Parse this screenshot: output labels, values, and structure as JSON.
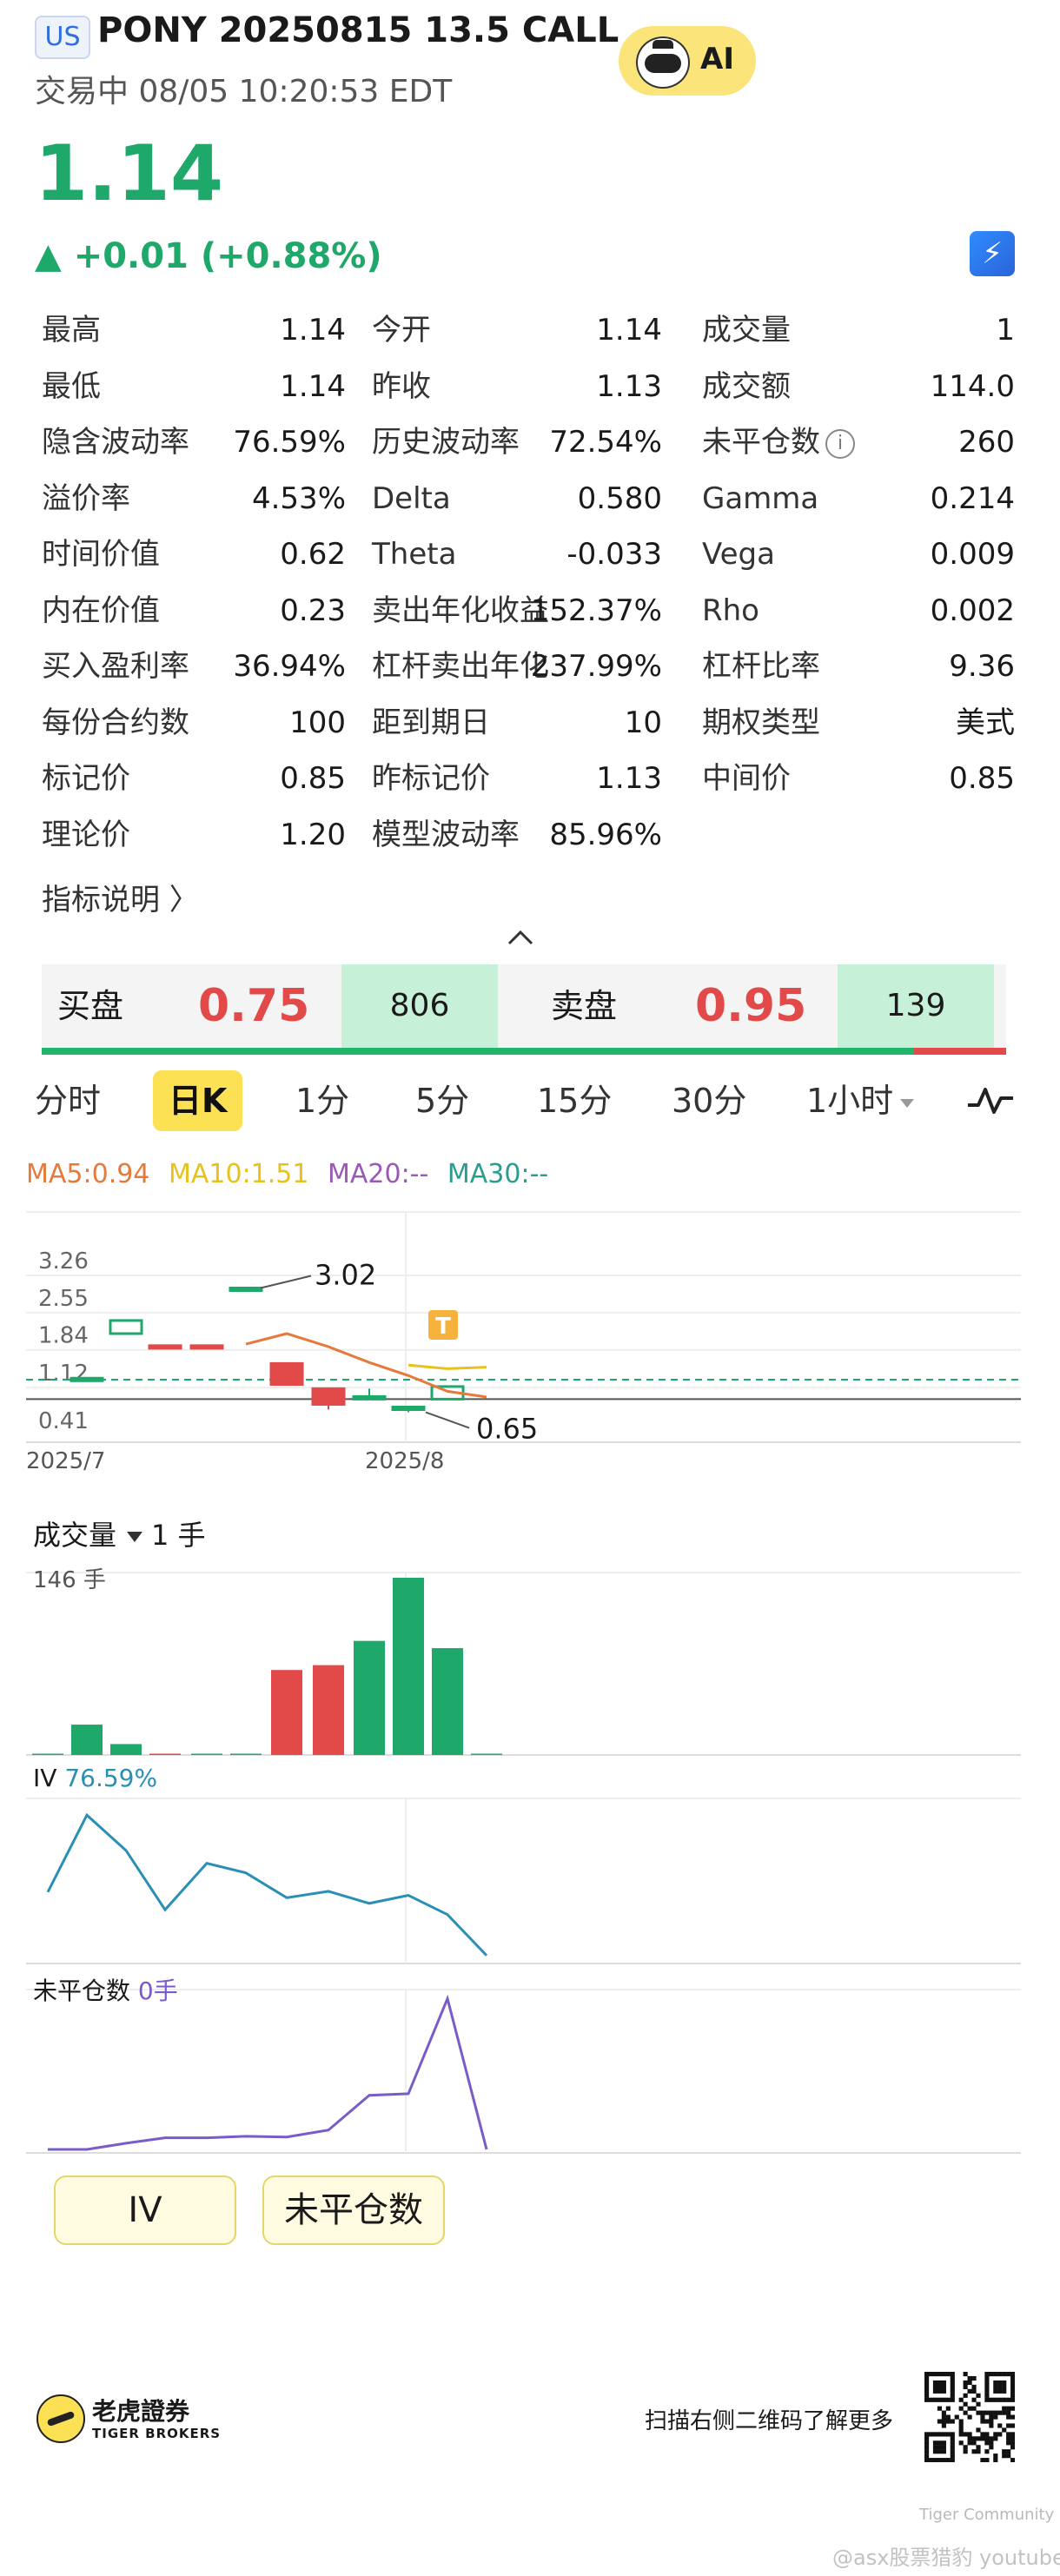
{
  "header": {
    "market": "US",
    "title": "PONY 20250815 13.5 CALL",
    "status": "交易中 08/05 10:20:53 EDT",
    "ai_label": "AI"
  },
  "quote": {
    "price": "1.14",
    "change": "▲ +0.01 (+0.88%)",
    "color_up": "#1ea86a",
    "color_down": "#e24a4a"
  },
  "stats": [
    [
      [
        "最高",
        "1.14"
      ],
      [
        "今开",
        "1.14"
      ],
      [
        "成交量",
        "1"
      ]
    ],
    [
      [
        "最低",
        "1.14"
      ],
      [
        "昨收",
        "1.13"
      ],
      [
        "成交额",
        "114.0"
      ]
    ],
    [
      [
        "隐含波动率",
        "76.59%"
      ],
      [
        "历史波动率",
        "72.54%"
      ],
      [
        "未平仓数",
        "260"
      ]
    ],
    [
      [
        "溢价率",
        "4.53%"
      ],
      [
        "Delta",
        "0.580"
      ],
      [
        "Gamma",
        "0.214"
      ]
    ],
    [
      [
        "时间价值",
        "0.62"
      ],
      [
        "Theta",
        "-0.033"
      ],
      [
        "Vega",
        "0.009"
      ]
    ],
    [
      [
        "内在价值",
        "0.23"
      ],
      [
        "卖出年化收益",
        "152.37%"
      ],
      [
        "Rho",
        "0.002"
      ]
    ],
    [
      [
        "买入盈利率",
        "36.94%"
      ],
      [
        "杠杆卖出年化",
        "237.99%"
      ],
      [
        "杠杆比率",
        "9.36"
      ]
    ],
    [
      [
        "每份合约数",
        "100"
      ],
      [
        "距到期日",
        "10"
      ],
      [
        "期权类型",
        "美式"
      ]
    ],
    [
      [
        "标记价",
        "0.85"
      ],
      [
        "昨标记价",
        "1.13"
      ],
      [
        "中间价",
        "0.85"
      ]
    ],
    [
      [
        "理论价",
        "1.20"
      ],
      [
        "模型波动率",
        "85.96%"
      ],
      [
        "",
        ""
      ]
    ]
  ],
  "indicator_link": "指标说明 〉",
  "order_book": {
    "bid_label": "买盘",
    "bid_price": "0.75",
    "bid_size": "806",
    "ask_label": "卖盘",
    "ask_price": "0.95",
    "ask_size": "139"
  },
  "tabs": [
    "分时",
    "日K",
    "1分",
    "5分",
    "15分",
    "30分",
    "1小时"
  ],
  "active_tab": "日K",
  "ma": {
    "ma5": "MA5:0.94",
    "ma10": "MA10:1.51",
    "ma20": "MA20:--",
    "ma30": "MA30:--",
    "colors": {
      "ma5": "#e57a3a",
      "ma10": "#e8c21c",
      "ma20": "#9b59b6",
      "ma30": "#2a9d8f"
    }
  },
  "chart_data": [
    {
      "type": "candlestick",
      "y_ticks": [
        "3.26",
        "2.55",
        "1.84",
        "1.12",
        "0.41"
      ],
      "x_labels": [
        "2025/7",
        "2025/8"
      ],
      "annotations": [
        "3.02",
        "0.65"
      ],
      "reference_line": 1.14,
      "candles": [
        {
          "open": 1.3,
          "close": 1.3,
          "high": 1.3,
          "low": 1.3,
          "dir": "up"
        },
        {
          "open": 2.15,
          "close": 2.4,
          "high": 2.4,
          "low": 2.15,
          "dir": "up"
        },
        {
          "open": 1.92,
          "close": 1.92,
          "high": 1.92,
          "low": 1.92,
          "dir": "down"
        },
        {
          "open": 1.92,
          "close": 1.92,
          "high": 1.92,
          "low": 1.92,
          "dir": "down"
        },
        {
          "open": 3.02,
          "close": 3.02,
          "high": 3.02,
          "low": 3.02,
          "dir": "up"
        },
        {
          "open": 1.58,
          "close": 1.18,
          "high": 1.58,
          "low": 1.18,
          "dir": "down"
        },
        {
          "open": 1.1,
          "close": 0.8,
          "high": 1.1,
          "low": 0.7,
          "dir": "down"
        },
        {
          "open": 0.95,
          "close": 0.95,
          "high": 1.1,
          "low": 0.9,
          "dir": "up"
        },
        {
          "open": 0.7,
          "close": 0.75,
          "high": 0.75,
          "low": 0.65,
          "dir": "up"
        },
        {
          "open": 0.9,
          "close": 1.14,
          "high": 1.14,
          "low": 0.9,
          "dir": "up"
        }
      ],
      "ma5": [
        null,
        null,
        null,
        null,
        1.95,
        2.15,
        1.9,
        1.6,
        1.35,
        1.05,
        0.94
      ],
      "ma10": [
        null,
        null,
        null,
        null,
        null,
        null,
        null,
        null,
        1.55,
        1.48,
        1.51
      ]
    },
    {
      "type": "bar",
      "title": "成交量",
      "unit": "1 手",
      "max_label": "146 手",
      "values": [
        0,
        25,
        9,
        1,
        0,
        0,
        70,
        74,
        94,
        146,
        88,
        0
      ],
      "colors": [
        "up",
        "up",
        "up",
        "down",
        "up",
        "up",
        "down",
        "down",
        "up",
        "up",
        "up",
        "up"
      ]
    },
    {
      "type": "line",
      "title": "IV",
      "value_label": "76.59%",
      "values": [
        1.04,
        2.0,
        1.56,
        0.82,
        1.4,
        1.28,
        0.97,
        1.05,
        0.9,
        1.0,
        0.76,
        0.25
      ]
    },
    {
      "type": "line",
      "title": "未平仓数",
      "value_label": "0手",
      "values": [
        0,
        0,
        8,
        15,
        15,
        17,
        16,
        25,
        70,
        72,
        195,
        0
      ]
    }
  ],
  "indicator_buttons": [
    "IV",
    "未平仓数"
  ],
  "footer": {
    "brand_cn": "老虎證券",
    "brand_en": "TIGER BROKERS",
    "scan_text": "扫描右侧二维码了解更多",
    "watermark_community": "Tiger Community",
    "watermark_channel": "@asx股票猎豹 youtube"
  }
}
